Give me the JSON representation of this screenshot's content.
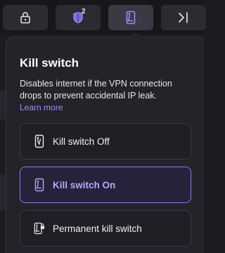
{
  "toolbar": {
    "buttons": [
      {
        "icon": "lock-icon"
      },
      {
        "icon": "shield-icon",
        "badge": "2"
      },
      {
        "icon": "kill-switch-icon"
      },
      {
        "icon": "collapse-panel-icon"
      }
    ]
  },
  "kill_switch": {
    "title": "Kill switch",
    "description": "Disables internet if the VPN connection drops to prevent accidental IP leak.",
    "learn_more": "Learn more",
    "options": [
      {
        "label": "Kill switch Off",
        "icon": "kill-switch-off-icon",
        "selected": false
      },
      {
        "label": "Kill switch On",
        "icon": "kill-switch-on-icon",
        "selected": true
      },
      {
        "label": "Permanent kill switch",
        "icon": "permanent-kill-switch-icon",
        "selected": false
      }
    ]
  },
  "colors": {
    "accent": "#8e7bf0",
    "accent_text": "#b5a7ff",
    "link": "#a08cff",
    "panel_bg": "#23232a",
    "page_bg": "#1b1b20"
  }
}
